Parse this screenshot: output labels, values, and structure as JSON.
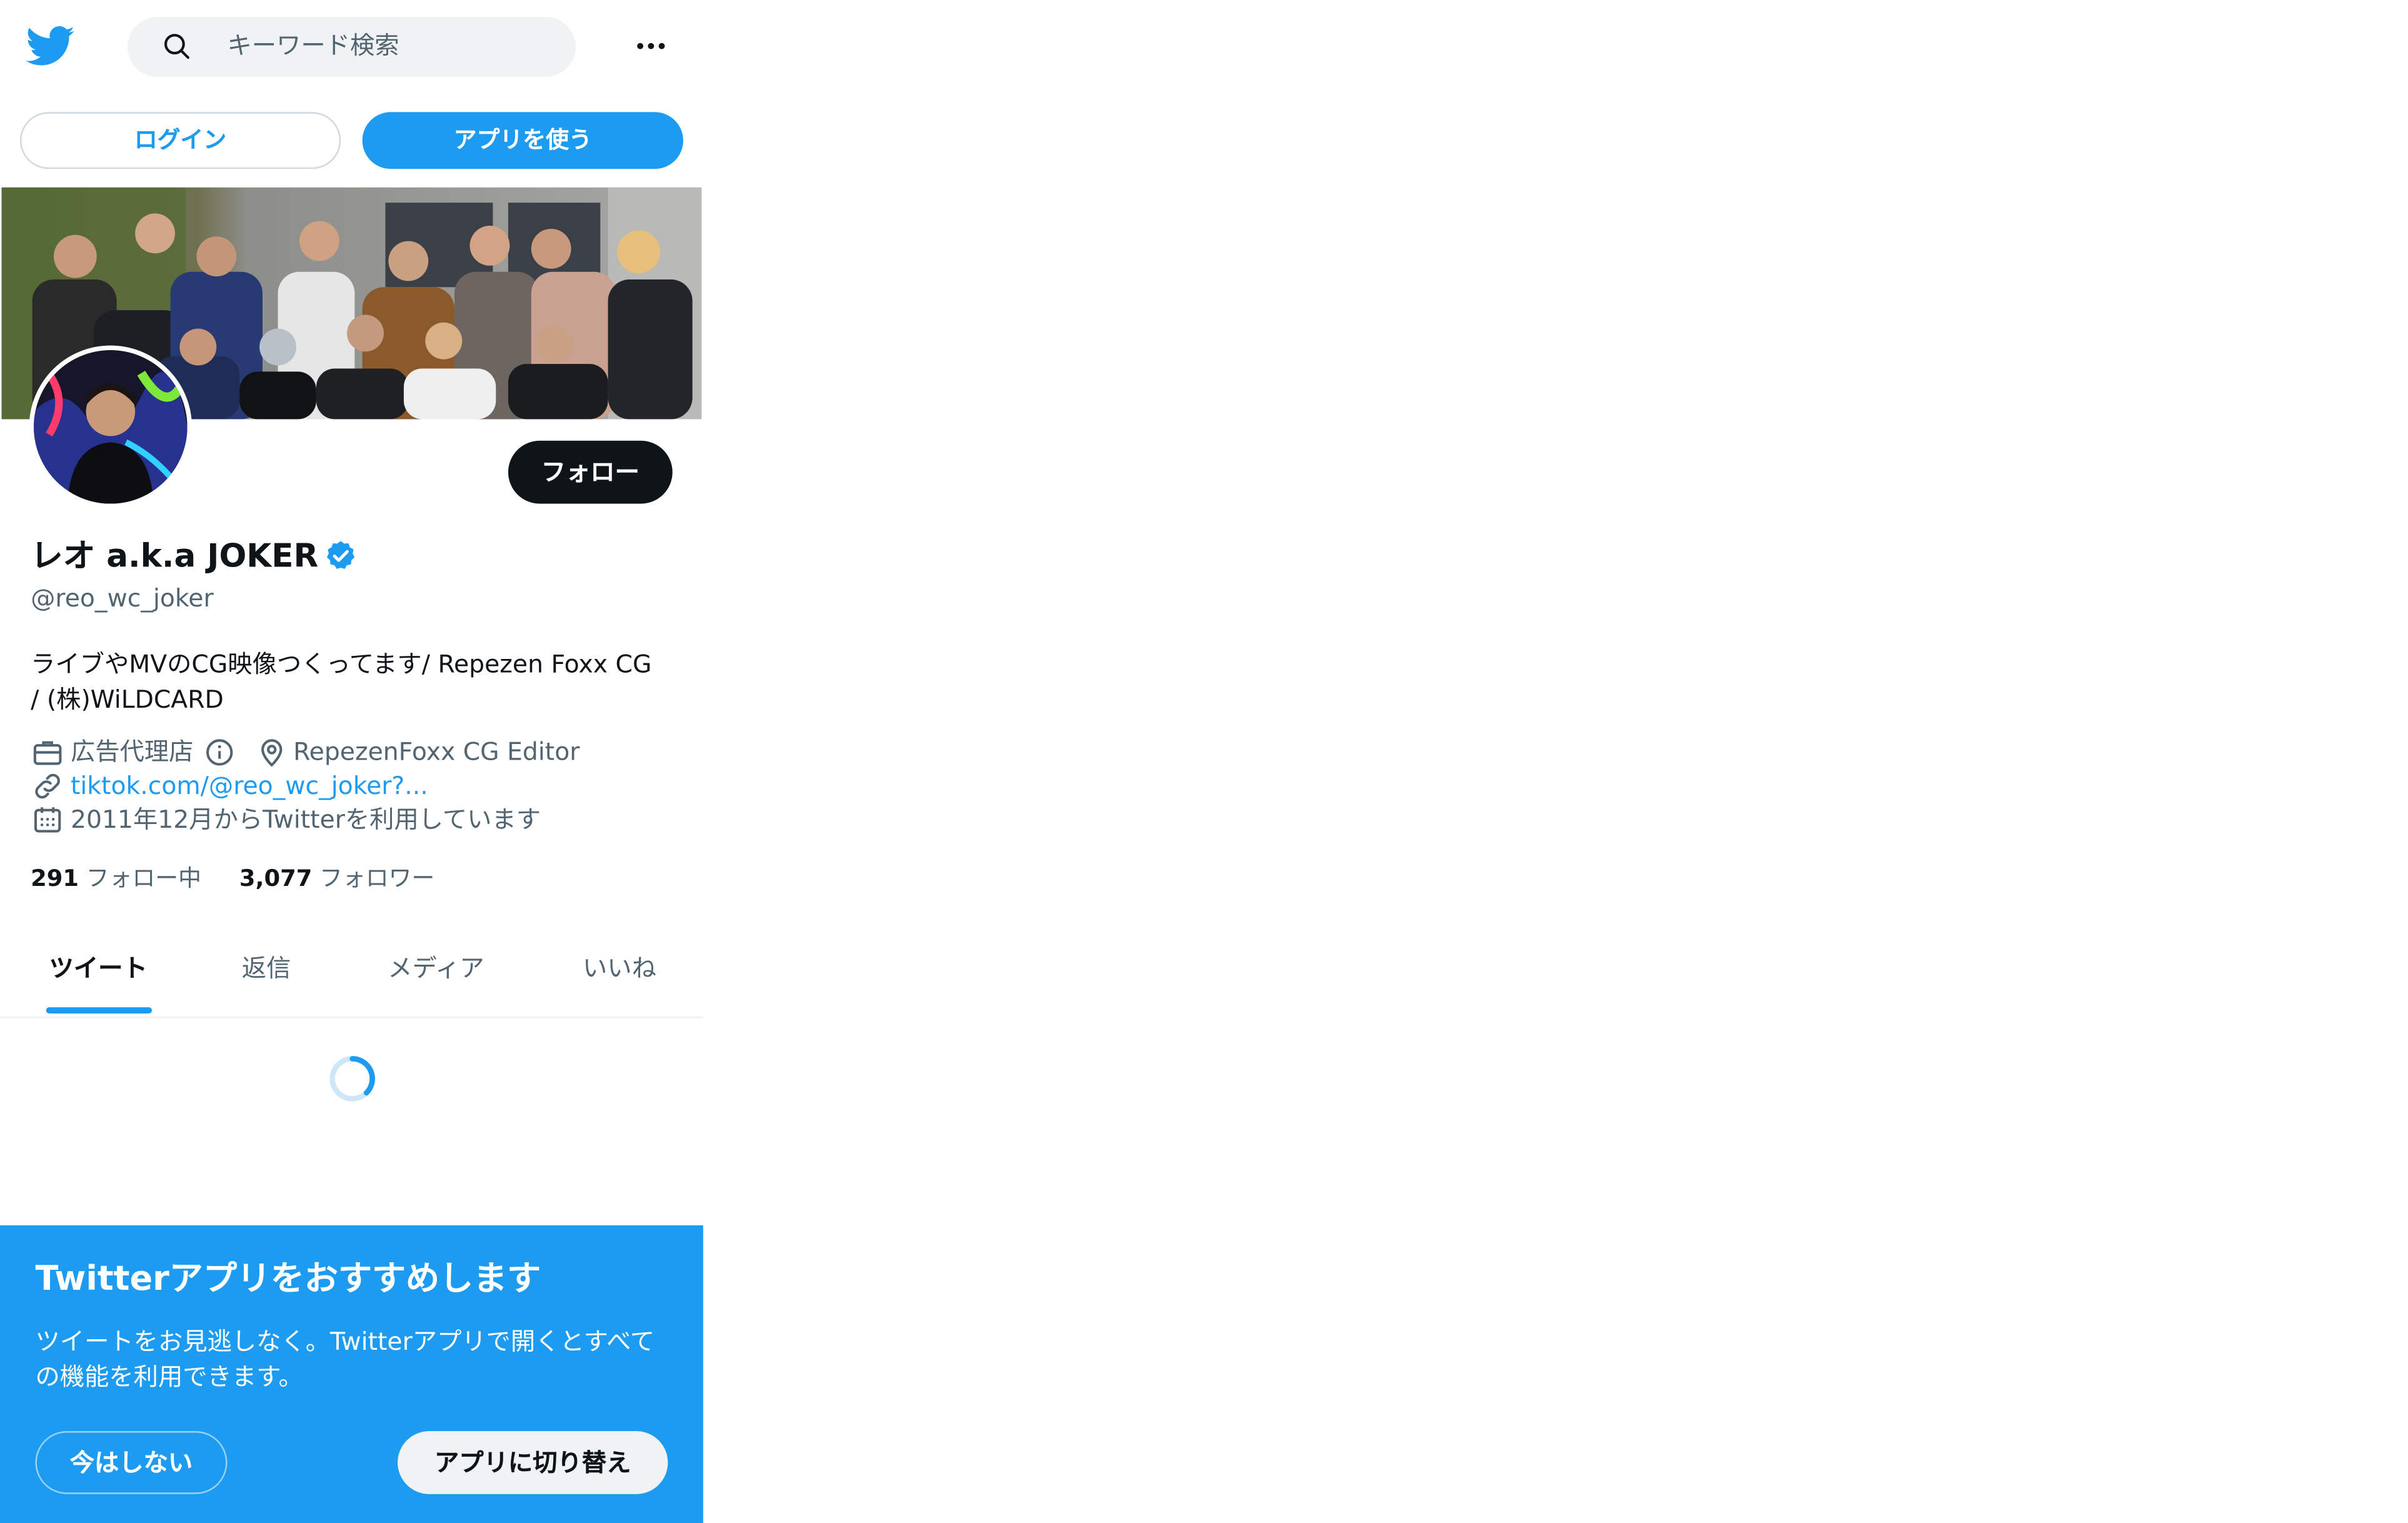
{
  "header": {
    "search_placeholder": "キーワード検索"
  },
  "auth": {
    "login_label": "ログイン",
    "use_app_label": "アプリを使う"
  },
  "profile": {
    "follow_label": "フォロー",
    "display_name": "レオ a.k.a JOKER",
    "handle": "@reo_wc_joker",
    "bio": "ライブやMVのCG映像つくってます/ Repezen Foxx CG / (株)WiLDCARD",
    "category": "広告代理店",
    "location": "RepezenFoxx CG Editor",
    "link": "tiktok.com/@reo_wc_joker?...",
    "joined": "2011年12月からTwitterを利用しています",
    "following_count": "291",
    "following_label": "フォロー中",
    "followers_count": "3,077",
    "followers_label": "フォロワー"
  },
  "tabs": [
    "ツイート",
    "返信",
    "メディア",
    "いいね"
  ],
  "promo": {
    "title": "Twitterアプリをおすすめします",
    "text": "ツイートをお見逃しなく。Twitterアプリで開くとすべての機能を利用できます。",
    "not_now_label": "今はしない",
    "switch_label": "アプリに切り替え"
  },
  "colors": {
    "accent": "#1d9bf0",
    "text": "#0f1419",
    "muted": "#536471"
  }
}
